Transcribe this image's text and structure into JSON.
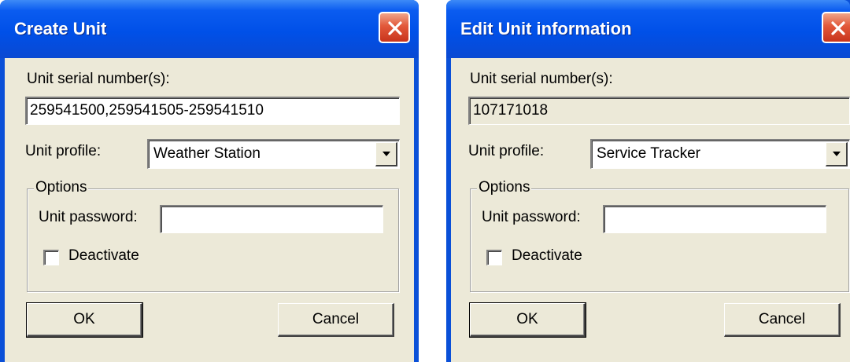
{
  "create_dialog": {
    "title": "Create Unit",
    "serial_label": "Unit serial number(s):",
    "serial_value": "259541500,259541505-259541510",
    "profile_label": "Unit profile:",
    "profile_value": "Weather Station",
    "options_title": "Options",
    "password_label": "Unit password:",
    "password_value": "",
    "deactivate_label": "Deactivate",
    "deactivate_checked": false,
    "ok_label": "OK",
    "cancel_label": "Cancel"
  },
  "edit_dialog": {
    "title": "Edit Unit information",
    "serial_label": "Unit serial number(s):",
    "serial_value": "107171018",
    "profile_label": "Unit profile:",
    "profile_value": "Service Tracker",
    "options_title": "Options",
    "password_label": "Unit password:",
    "password_value": "",
    "deactivate_label": "Deactivate",
    "deactivate_checked": false,
    "ok_label": "OK",
    "cancel_label": "Cancel"
  },
  "colors": {
    "titlebar": "#0050e8",
    "dialog_face": "#ece9d8",
    "close_button": "#e2583a"
  },
  "icons": {
    "close": "close-x-icon",
    "dropdown": "chevron-down-icon"
  }
}
